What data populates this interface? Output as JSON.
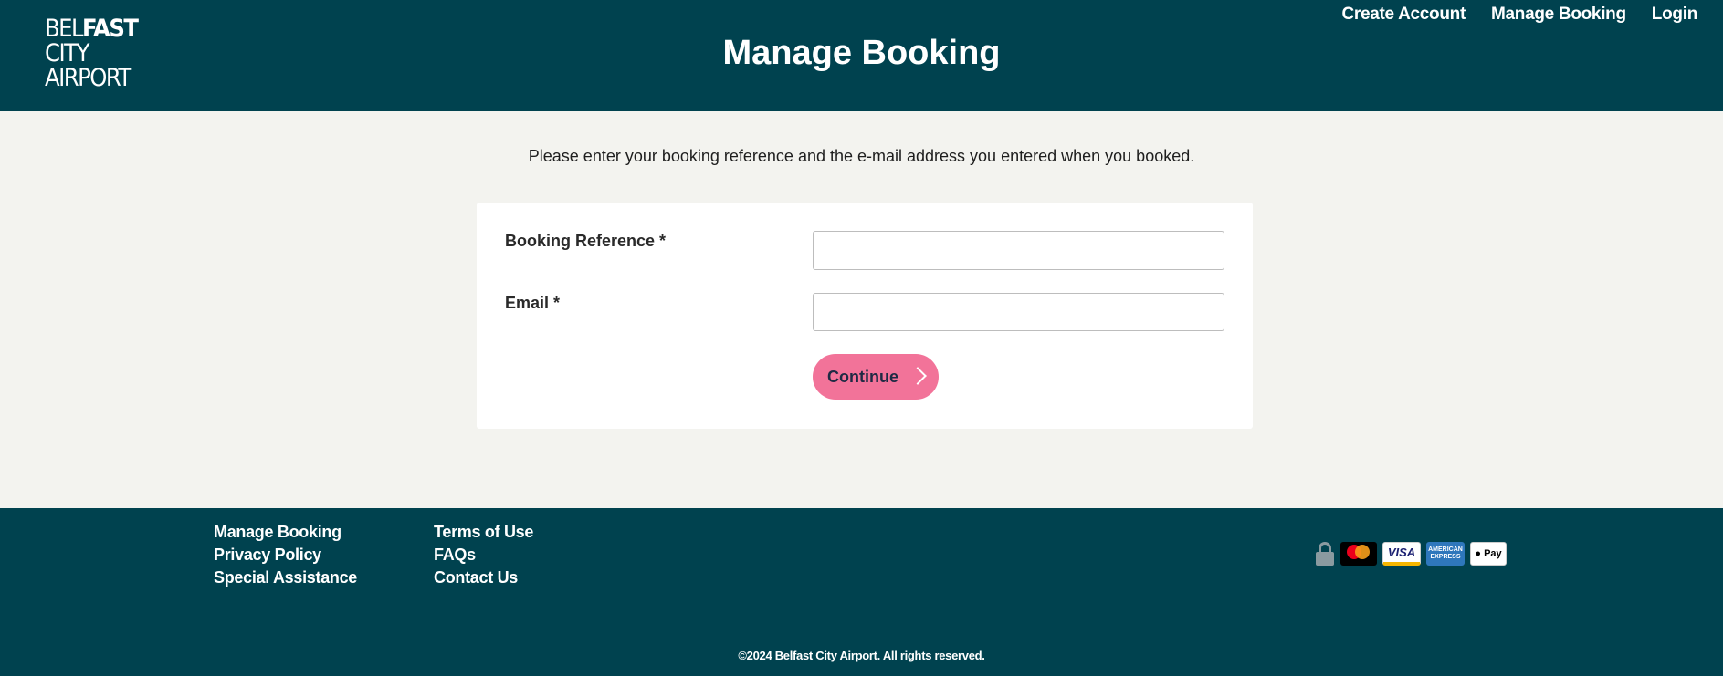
{
  "header": {
    "logo": {
      "line1_thin": "BEL",
      "line1_bold": "FAST",
      "line2": "CITY",
      "line3": "AIRPORT"
    },
    "title": "Manage Booking",
    "nav": [
      {
        "label": "Create Account"
      },
      {
        "label": "Manage Booking"
      },
      {
        "label": "Login"
      }
    ]
  },
  "main": {
    "intro": "Please enter your booking reference and the e-mail address you entered when you booked.",
    "form": {
      "booking_reference_label": "Booking Reference *",
      "booking_reference_value": "",
      "email_label": "Email *",
      "email_value": "",
      "continue_label": "Continue"
    }
  },
  "footer": {
    "col1": [
      {
        "label": "Manage Booking"
      },
      {
        "label": "Privacy Policy"
      },
      {
        "label": "Special Assistance"
      }
    ],
    "col2": [
      {
        "label": "Terms of Use"
      },
      {
        "label": "FAQs"
      },
      {
        "label": "Contact Us"
      }
    ],
    "payment_icons": [
      "lock-icon",
      "mastercard-icon",
      "visa-icon",
      "amex-icon",
      "apple-pay-icon"
    ],
    "payment_text": {
      "visa": "VISA",
      "amex_line1": "AMERICAN",
      "amex_line2": "EXPRESS",
      "apay": "Pay"
    },
    "copyright": "©2024 Belfast City Airport. All rights reserved."
  },
  "colors": {
    "brand_dark": "#00424f",
    "background": "#f3f3ef",
    "accent_pink": "#f27399"
  }
}
